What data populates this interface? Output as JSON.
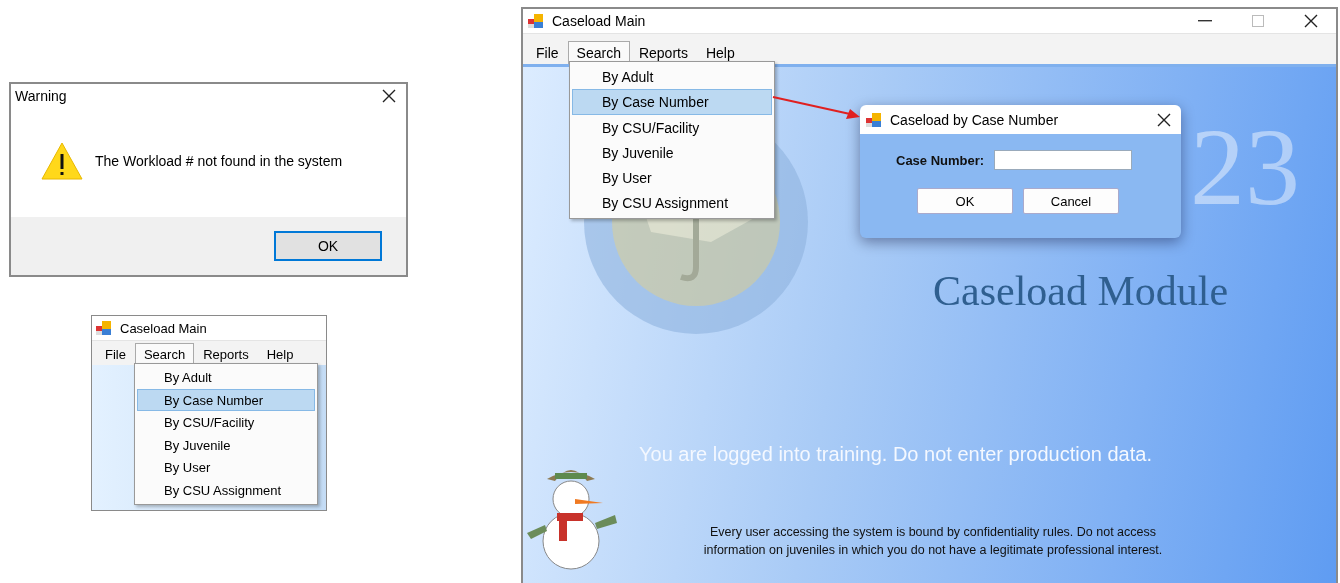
{
  "warning_dialog": {
    "title": "Warning",
    "message": "The Workload # not found in the system",
    "buttons": [
      {
        "label": "OK",
        "selected": true
      }
    ]
  },
  "small_window": {
    "title": "Caseload Main",
    "menu_bar": [
      {
        "label": "File",
        "selected": false
      },
      {
        "label": "Search",
        "selected": true
      },
      {
        "label": "Reports",
        "selected": false
      },
      {
        "label": "Help",
        "selected": false
      }
    ],
    "search_menu": [
      {
        "label": "By Adult",
        "selected": false
      },
      {
        "label": "By Case Number",
        "selected": true
      },
      {
        "label": "By CSU/Facility",
        "selected": false
      },
      {
        "label": "By Juvenile",
        "selected": false
      },
      {
        "label": "By User",
        "selected": false
      },
      {
        "label": "By CSU Assignment",
        "selected": false
      }
    ]
  },
  "main_window": {
    "title": "Caseload Main",
    "menu_bar": [
      {
        "label": "File",
        "selected": false
      },
      {
        "label": "Search",
        "selected": true
      },
      {
        "label": "Reports",
        "selected": false
      },
      {
        "label": "Help",
        "selected": false
      }
    ],
    "search_menu": [
      {
        "label": "By Adult",
        "selected": false
      },
      {
        "label": "By Case Number",
        "selected": true
      },
      {
        "label": "By CSU/Facility",
        "selected": false
      },
      {
        "label": "By Juvenile",
        "selected": false
      },
      {
        "label": "By User",
        "selected": false
      },
      {
        "label": "By CSU Assignment",
        "selected": false
      }
    ],
    "background_number": "23",
    "module_title": "Caseload Module",
    "training_notice": "You are logged into training. Do not enter production data.",
    "confidentiality_notice": "Every user accessing the system is bound by confidentiality rules. Do not access information on juveniles in which you do not have a legitimate professional interest."
  },
  "case_number_dialog": {
    "title": "Caseload by Case Number",
    "field_label": "Case Number:",
    "buttons": [
      {
        "label": "OK"
      },
      {
        "label": "Cancel"
      }
    ]
  }
}
